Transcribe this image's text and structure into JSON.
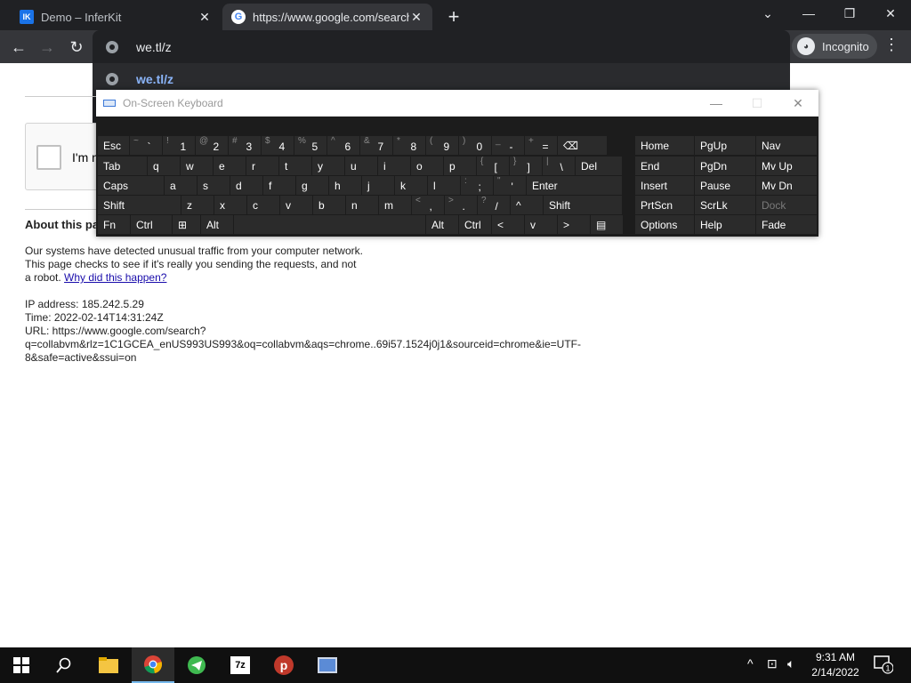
{
  "browser": {
    "tabs": [
      {
        "title": "Demo – InferKit",
        "favicon": "IK"
      },
      {
        "title": "https://www.google.com/search?",
        "favicon": "G"
      }
    ],
    "window_controls": [
      "chevron-down",
      "minimize",
      "restore",
      "close"
    ],
    "omnibox": {
      "input_value": "we.tl/z",
      "suggestion": "we.tl/z"
    },
    "incognito_label": "Incognito"
  },
  "page": {
    "captcha_text": "I'm n",
    "about_heading": "About this pa",
    "paragraph_text": "Our systems have detected unusual traffic from your computer network. This page checks to see if it's really you sending the requests, and not a robot.",
    "paragraph_link": "Why did this happen?",
    "ip_line": "IP address: 185.242.5.29",
    "time_line": "Time: 2022-02-14T14:31:24Z",
    "url_line1": "URL: https://www.google.com/search?",
    "url_line2": "q=collabvm&rlz=1C1GCEA_enUS993US993&oq=collabvm&aqs=chrome..69i57.1524j0j1&sourceid=chrome&ie=UTF-",
    "url_line3": "8&safe=active&ssui=on"
  },
  "osk": {
    "title": "On-Screen Keyboard",
    "row1": [
      {
        "main": "Esc"
      },
      {
        "shift": "~",
        "main": "`"
      },
      {
        "shift": "!",
        "main": "1"
      },
      {
        "shift": "@",
        "main": "2"
      },
      {
        "shift": "#",
        "main": "3"
      },
      {
        "shift": "$",
        "main": "4"
      },
      {
        "shift": "%",
        "main": "5"
      },
      {
        "shift": "^",
        "main": "6"
      },
      {
        "shift": "&",
        "main": "7"
      },
      {
        "shift": "*",
        "main": "8"
      },
      {
        "shift": "(",
        "main": "9"
      },
      {
        "shift": ")",
        "main": "0"
      },
      {
        "shift": "_",
        "main": "-"
      },
      {
        "shift": "+",
        "main": "="
      },
      {
        "main": "⌫"
      }
    ],
    "row2": [
      {
        "main": "Tab"
      },
      {
        "main": "q"
      },
      {
        "main": "w"
      },
      {
        "main": "e"
      },
      {
        "main": "r"
      },
      {
        "main": "t"
      },
      {
        "main": "y"
      },
      {
        "main": "u"
      },
      {
        "main": "i"
      },
      {
        "main": "o"
      },
      {
        "main": "p"
      },
      {
        "shift": "{",
        "main": "["
      },
      {
        "shift": "}",
        "main": "]"
      },
      {
        "shift": "|",
        "main": "\\"
      },
      {
        "main": "Del"
      }
    ],
    "row3": [
      {
        "main": "Caps"
      },
      {
        "main": "a"
      },
      {
        "main": "s"
      },
      {
        "main": "d"
      },
      {
        "main": "f"
      },
      {
        "main": "g"
      },
      {
        "main": "h"
      },
      {
        "main": "j"
      },
      {
        "main": "k"
      },
      {
        "main": "l"
      },
      {
        "shift": ":",
        "main": ";"
      },
      {
        "shift": "\"",
        "main": "'"
      },
      {
        "main": "Enter"
      }
    ],
    "row4": [
      {
        "main": "Shift"
      },
      {
        "main": "z"
      },
      {
        "main": "x"
      },
      {
        "main": "c"
      },
      {
        "main": "v"
      },
      {
        "main": "b"
      },
      {
        "main": "n"
      },
      {
        "main": "m"
      },
      {
        "shift": "<",
        "main": ","
      },
      {
        "shift": ">",
        "main": "."
      },
      {
        "shift": "?",
        "main": "/"
      },
      {
        "main": "^"
      },
      {
        "main": "Shift"
      }
    ],
    "row5": [
      {
        "main": "Fn"
      },
      {
        "main": "Ctrl"
      },
      {
        "main": "⊞"
      },
      {
        "main": "Alt"
      },
      {
        "main": ""
      },
      {
        "main": "Alt"
      },
      {
        "main": "Ctrl"
      },
      {
        "main": "<"
      },
      {
        "main": "v"
      },
      {
        "main": ">"
      },
      {
        "main": "▤"
      }
    ],
    "nav_keys": [
      [
        "Home",
        "PgUp",
        "Nav"
      ],
      [
        "End",
        "PgDn",
        "Mv Up"
      ],
      [
        "Insert",
        "Pause",
        "Mv Dn"
      ],
      [
        "PrtScn",
        "ScrLk",
        "Dock"
      ],
      [
        "Options",
        "Help",
        "Fade"
      ]
    ]
  },
  "taskbar": {
    "apps": [
      "start",
      "search",
      "file-explorer",
      "chrome",
      "telegram",
      "7zip",
      "psiphon",
      "network-app"
    ],
    "clock_time": "9:31 AM",
    "clock_date": "2/14/2022",
    "notification_count": "1"
  },
  "colors": {
    "chrome_dark": "#202124",
    "chrome_toolbar": "#35363a",
    "link_blue": "#1a0dab",
    "suggestion_blue": "#8ab4f8",
    "osk_bg": "#1c1c1c",
    "osk_key": "#2b2b2b"
  }
}
